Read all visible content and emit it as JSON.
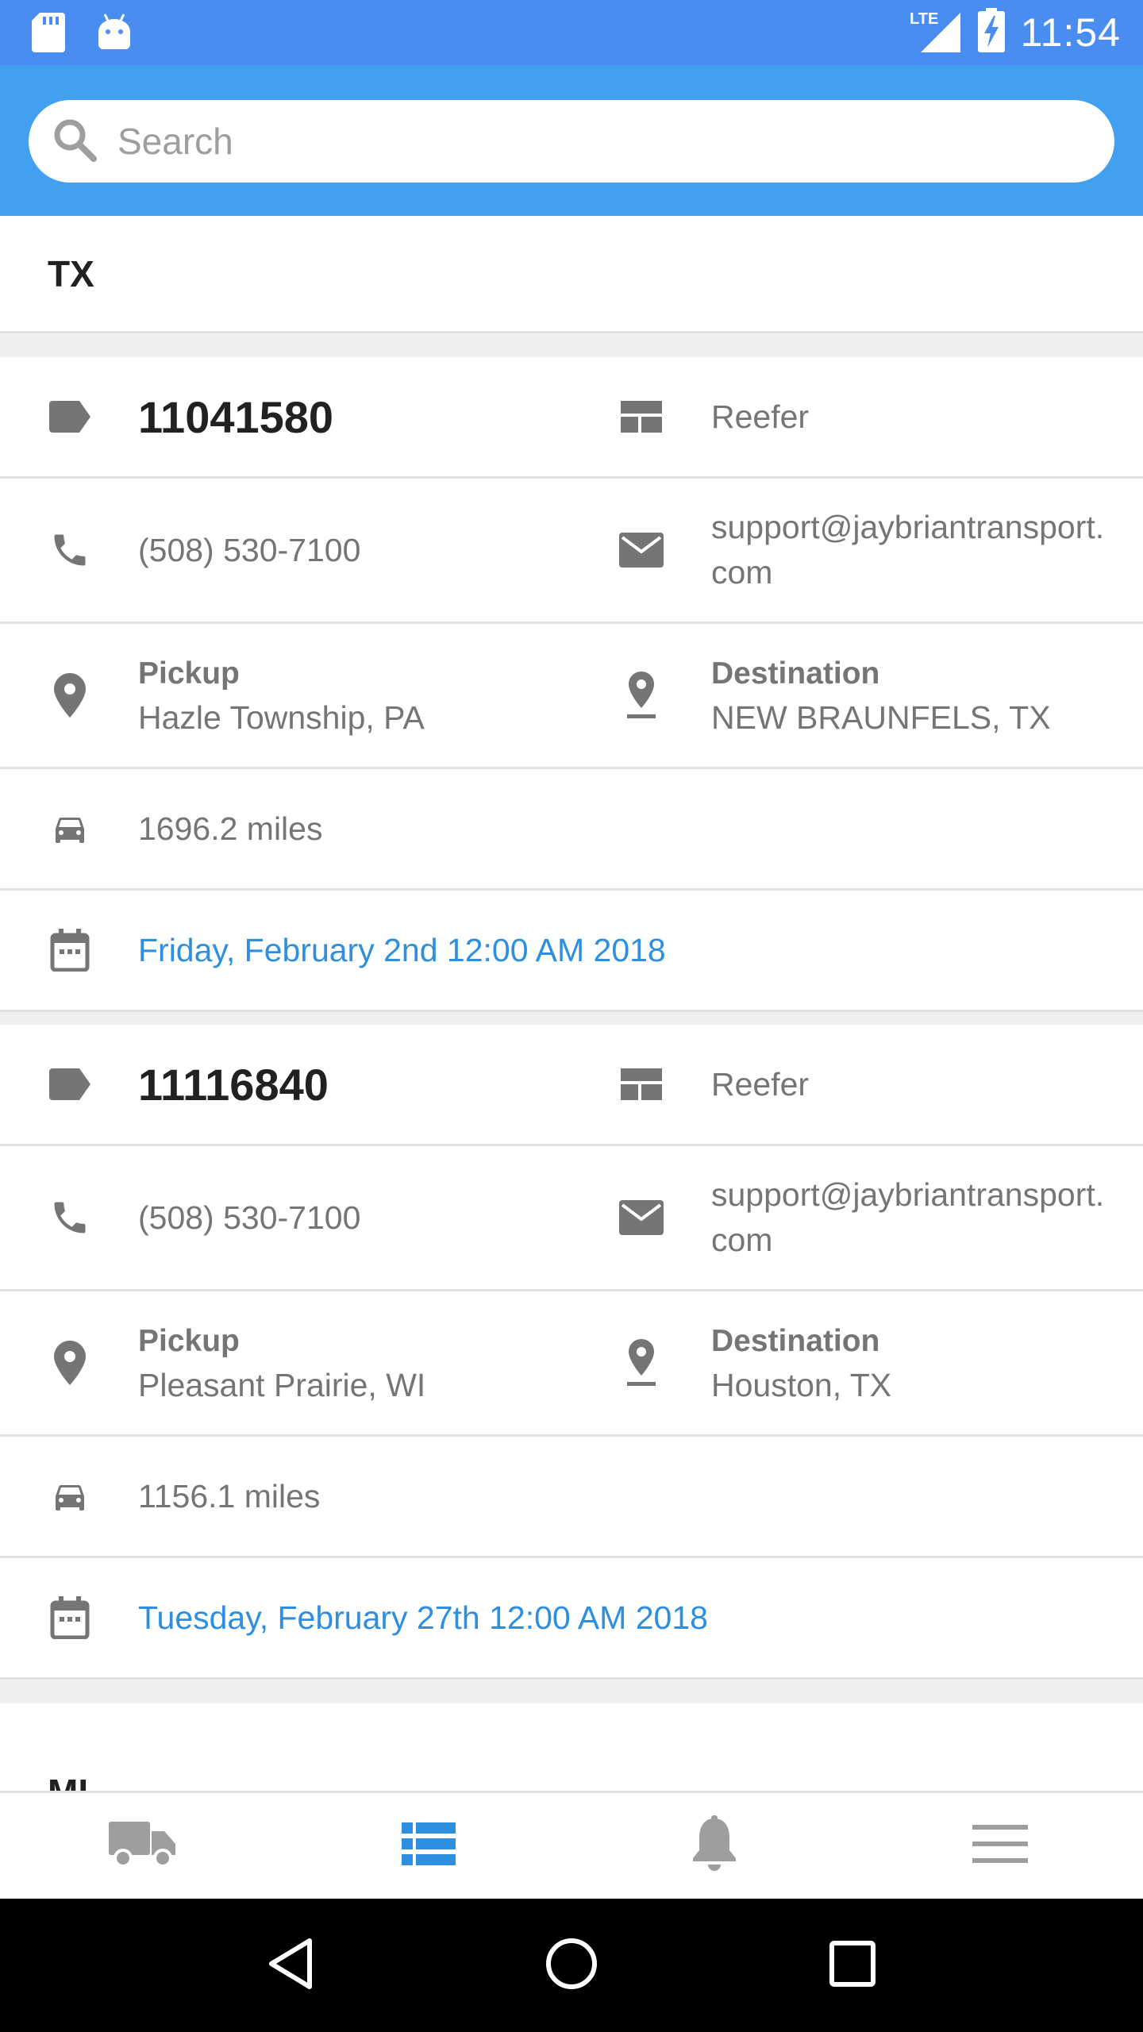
{
  "status_bar": {
    "time": "11:54",
    "network": "LTE"
  },
  "search": {
    "placeholder": "Search"
  },
  "sections": [
    {
      "title": "TX"
    },
    {
      "title": "MI"
    }
  ],
  "loads": [
    {
      "id": "11041580",
      "equipment": "Reefer",
      "phone": "(508) 530-7100",
      "email": "support@jaybriantransport.com",
      "pickup_label": "Pickup",
      "pickup": "Hazle Township, PA",
      "destination_label": "Destination",
      "destination": "NEW BRAUNFELS, TX",
      "distance": "1696.2 miles",
      "date": "Friday, February 2nd 12:00 AM 2018"
    },
    {
      "id": "11116840",
      "equipment": "Reefer",
      "phone": "(508) 530-7100",
      "email": "support@jaybriantransport.com",
      "pickup_label": "Pickup",
      "pickup": "Pleasant Prairie, WI",
      "destination_label": "Destination",
      "destination": "Houston, TX",
      "distance": "1156.1 miles",
      "date": "Tuesday, February 27th 12:00 AM 2018"
    }
  ],
  "bottom_nav": [
    {
      "icon": "truck-icon",
      "active": false
    },
    {
      "icon": "list-icon",
      "active": true
    },
    {
      "icon": "bell-icon",
      "active": false
    },
    {
      "icon": "menu-icon",
      "active": false
    }
  ],
  "colors": {
    "status_bar": "#4a8df0",
    "header": "#42a0f0",
    "accent": "#2e8fe0",
    "icon_gray": "#757575"
  }
}
